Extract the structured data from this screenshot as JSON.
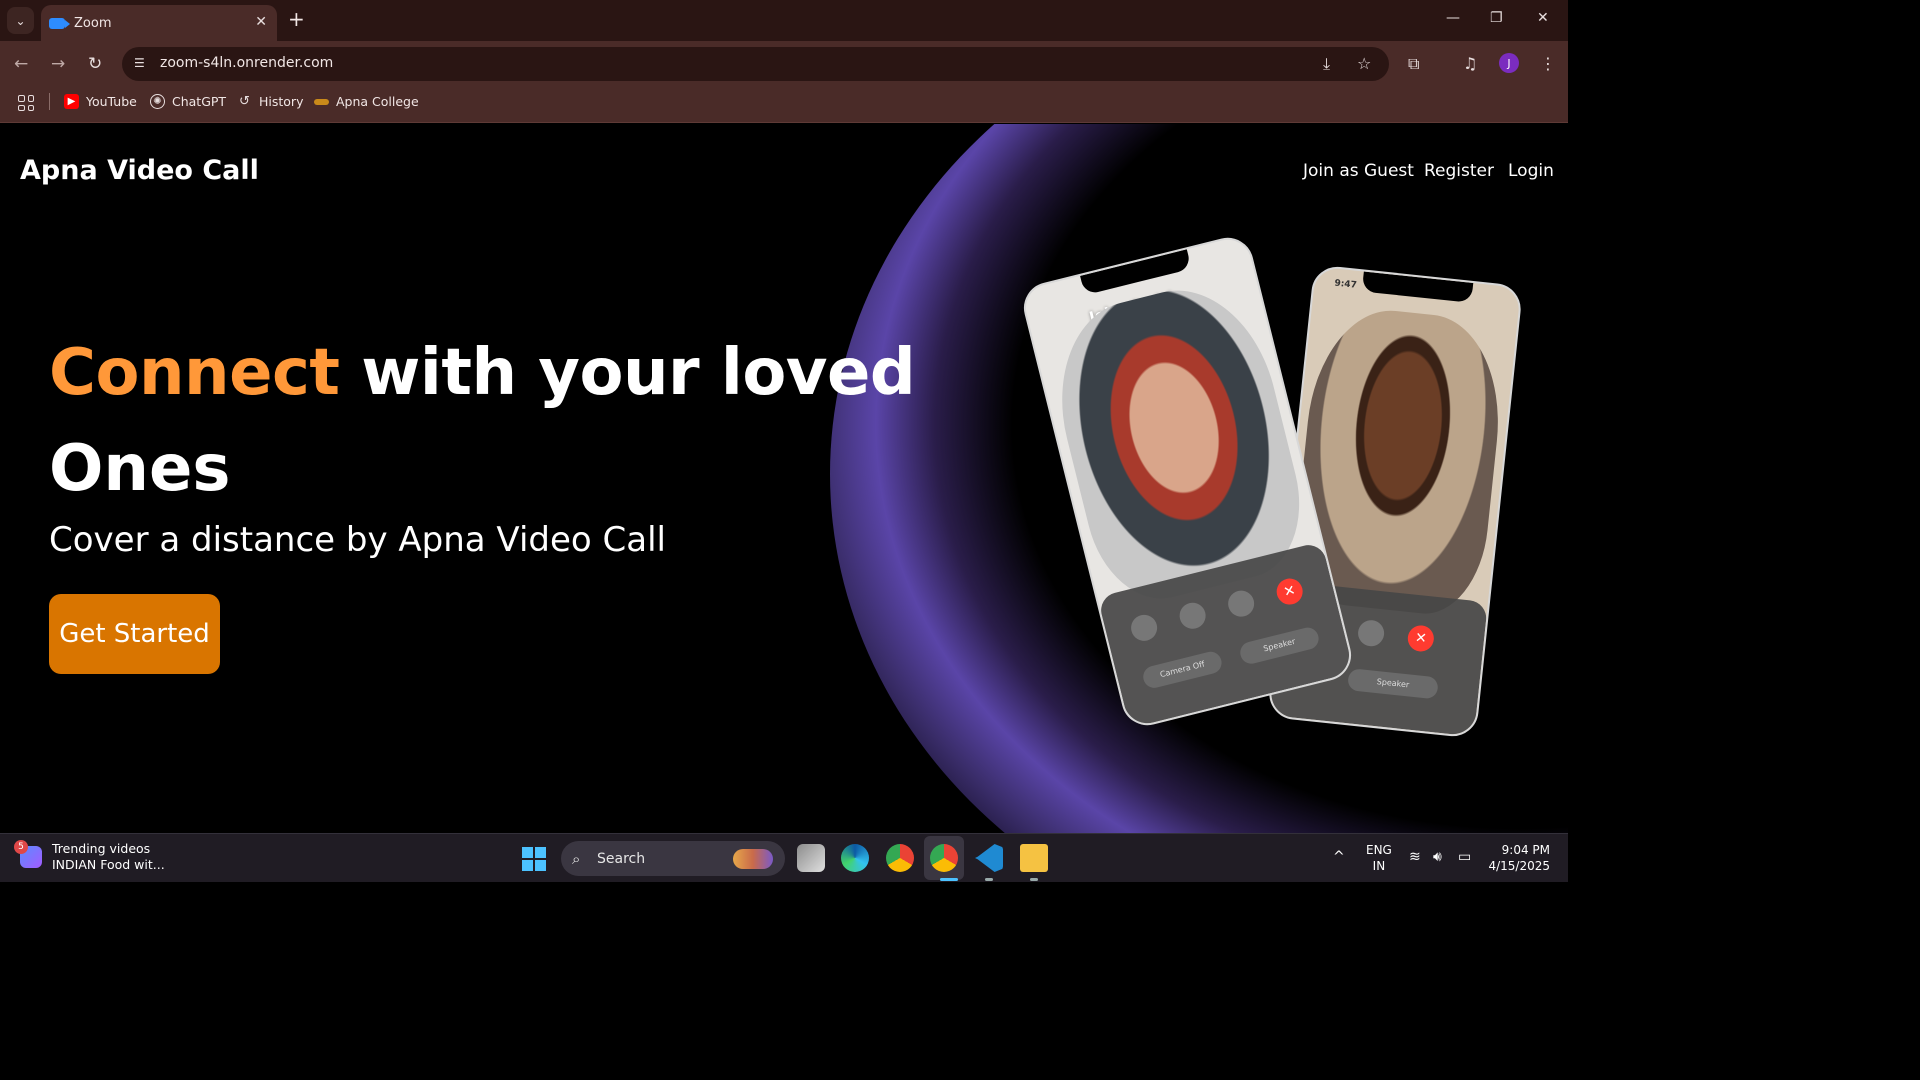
{
  "browser": {
    "tab_title": "Zoom",
    "tab_close": "✕",
    "new_tab": "+",
    "tab_list": "⌄",
    "window": {
      "minimize": "—",
      "restore": "❐",
      "close": "✕"
    },
    "nav": {
      "back": "←",
      "forward": "→",
      "reload": "↻"
    },
    "url": "zoom-s4ln.onrender.com",
    "profile_initial": "J",
    "bookmarks": [
      {
        "label": "YouTube",
        "icon": "youtube-icon"
      },
      {
        "label": "ChatGPT",
        "icon": "chatgpt-icon"
      },
      {
        "label": "History",
        "icon": "history-icon"
      },
      {
        "label": "Apna College",
        "icon": "apna-college-icon"
      }
    ]
  },
  "site": {
    "brand": "Apna Video Call",
    "nav": {
      "guest": "Join as Guest",
      "register": "Register",
      "login": "Login"
    },
    "hero": {
      "accent_word": "Connect",
      "line1_rest": " with your loved",
      "line2": "Ones",
      "subtitle": "Cover a distance by Apna Video Call",
      "cta": "Get Started"
    },
    "phones": {
      "left_name": "John Smith",
      "right_time": "9:47",
      "controls": [
        "effects",
        "mute",
        "flip",
        "end"
      ],
      "camera_off": "Camera Off",
      "speaker": "Speaker"
    },
    "colors": {
      "accent": "#ff9839",
      "cta": "#d97500"
    }
  },
  "taskbar": {
    "widget_badge": "5",
    "widget_title": "Trending videos",
    "widget_sub": "INDIAN Food wit...",
    "search_label": "Search",
    "lang_top": "ENG",
    "lang_bottom": "IN",
    "time": "9:04 PM",
    "date": "4/15/2025",
    "chevron": "^"
  }
}
